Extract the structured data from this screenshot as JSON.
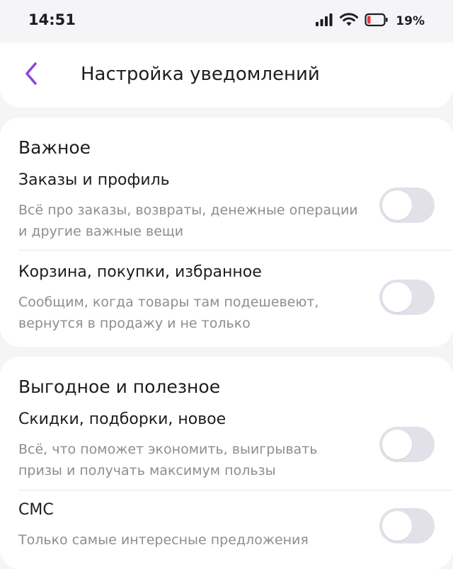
{
  "status_bar": {
    "time": "14:51",
    "battery_percent": "19%",
    "battery_level": 0.19,
    "battery_color": "#e53935",
    "icons": [
      "signal-icon",
      "wifi-icon",
      "battery-icon"
    ]
  },
  "header": {
    "title": "Настройка уведомлений",
    "back_icon": "chevron-left-icon",
    "accent_color": "#8e44dd"
  },
  "sections": [
    {
      "title": "Важное",
      "items": [
        {
          "title": "Заказы и профиль",
          "description": "Всё про заказы, возвраты, денежные операции и другие важные вещи",
          "enabled": false
        },
        {
          "title": "Корзина, покупки, избранное",
          "description": "Сообщим, когда товары там подешевеют, вернутся в продажу и не только",
          "enabled": false
        }
      ]
    },
    {
      "title": "Выгодное и полезное",
      "items": [
        {
          "title": "Скидки, подборки, новое",
          "description": "Всё, что поможет экономить, выигрывать призы и получать максимум пользы",
          "enabled": false
        },
        {
          "title": "СМС",
          "description": "Только самые интересные предложения",
          "enabled": false
        }
      ]
    }
  ]
}
